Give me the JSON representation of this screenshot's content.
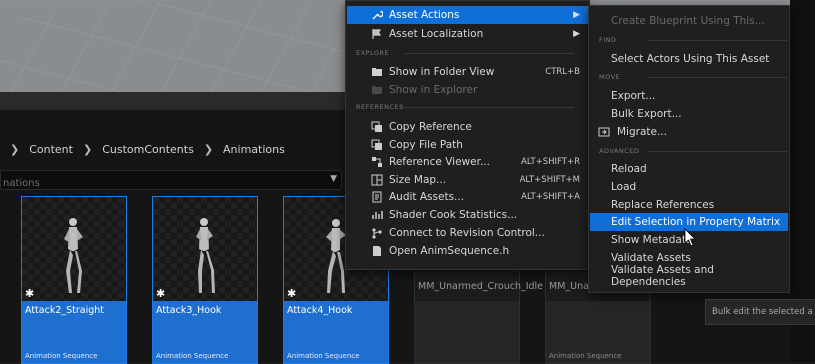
{
  "breadcrumb": [
    "Content",
    "CustomContents",
    "Animations"
  ],
  "search": {
    "value": "nations"
  },
  "assets": [
    {
      "name": "Attack2_Straight",
      "type": "Animation Sequence",
      "selected": true
    },
    {
      "name": "Attack3_Hook",
      "type": "Animation Sequence",
      "selected": true
    },
    {
      "name": "Attack4_Hook",
      "type": "Animation Sequence",
      "selected": true
    },
    {
      "name": "MM_Unarmed_Crouch_Idle",
      "type": "",
      "selected": false
    },
    {
      "name": "MM_Unarmed_Crouch_Walk_Fwd",
      "type": "Animation Sequence",
      "selected": false
    }
  ],
  "menu": {
    "asset_actions": "Asset Actions",
    "asset_localization": "Asset Localization",
    "section_explore": "EXPLORE",
    "show_in_folder_view": "Show in Folder View",
    "show_in_folder_view_shortcut": "CTRL+B",
    "show_in_explorer": "Show in Explorer",
    "section_references": "REFERENCES",
    "copy_reference": "Copy Reference",
    "copy_file_path": "Copy File Path",
    "reference_viewer": "Reference Viewer...",
    "reference_viewer_shortcut": "ALT+SHIFT+R",
    "size_map": "Size Map...",
    "size_map_shortcut": "ALT+SHIFT+M",
    "audit_assets": "Audit Assets...",
    "audit_assets_shortcut": "ALT+SHIFT+A",
    "shader_cook_statistics": "Shader Cook Statistics...",
    "connect_revision_control": "Connect to Revision Control...",
    "open_animsequence": "Open AnimSequence.h"
  },
  "submenu": {
    "create_blueprint": "Create Blueprint Using This...",
    "section_find": "FIND",
    "select_actors": "Select Actors Using This Asset",
    "section_move": "MOVE",
    "export": "Export...",
    "bulk_export": "Bulk Export...",
    "migrate": "Migrate...",
    "section_advanced": "ADVANCED",
    "reload": "Reload",
    "load": "Load",
    "replace_references": "Replace References",
    "edit_selection": "Edit Selection in Property Matrix",
    "show_metadata": "Show Metadata",
    "validate_assets": "Validate Assets",
    "validate_assets_deps": "Validate Assets and Dependencies"
  },
  "tooltip": "Bulk edit the selected a",
  "colors": {
    "highlight": "#0f6fd8",
    "selection": "#1f6fd0"
  }
}
